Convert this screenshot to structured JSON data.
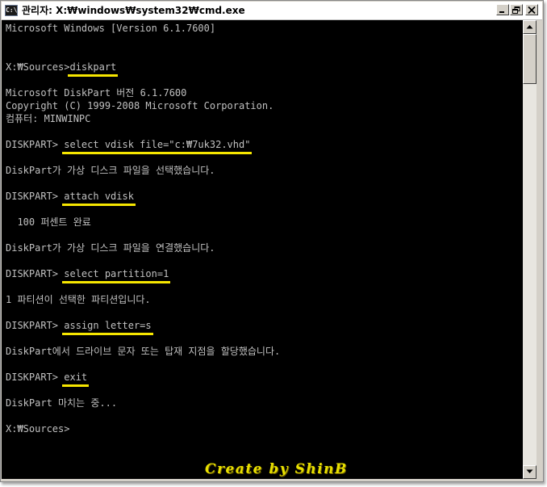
{
  "window": {
    "title": "관리자: X:₩windows₩system32₩cmd.exe",
    "icon_text": "C:\\"
  },
  "console": {
    "lines": [
      {
        "text": "Microsoft Windows [Version 6.1.7600]"
      },
      {
        "text": ""
      },
      {
        "text": ""
      },
      {
        "prompt": "X:₩Sources>",
        "command": "diskpart"
      },
      {
        "text": ""
      },
      {
        "text": "Microsoft DiskPart 버전 6.1.7600"
      },
      {
        "text": "Copyright (C) 1999-2008 Microsoft Corporation."
      },
      {
        "text": "컴퓨터: MINWINPC"
      },
      {
        "text": ""
      },
      {
        "prompt": "DISKPART> ",
        "command": "select vdisk file=\"c:₩7uk32.vhd\""
      },
      {
        "text": ""
      },
      {
        "text": "DiskPart가 가상 디스크 파일을 선택했습니다."
      },
      {
        "text": ""
      },
      {
        "prompt": "DISKPART> ",
        "command": "attach vdisk"
      },
      {
        "text": ""
      },
      {
        "text": "  100 퍼센트 완료"
      },
      {
        "text": ""
      },
      {
        "text": "DiskPart가 가상 디스크 파일을 연결했습니다."
      },
      {
        "text": ""
      },
      {
        "prompt": "DISKPART> ",
        "command": "select partition=1"
      },
      {
        "text": ""
      },
      {
        "text": "1 파티션이 선택한 파티션입니다."
      },
      {
        "text": ""
      },
      {
        "prompt": "DISKPART> ",
        "command": "assign letter=s"
      },
      {
        "text": ""
      },
      {
        "text": "DiskPart에서 드라이브 문자 또는 탑재 지점을 할당했습니다."
      },
      {
        "text": ""
      },
      {
        "prompt": "DISKPART> ",
        "command": "exit"
      },
      {
        "text": ""
      },
      {
        "text": "DiskPart 마치는 중..."
      },
      {
        "text": ""
      },
      {
        "text": "X:₩Sources>"
      }
    ]
  },
  "watermark": {
    "text": "Create by ShinB"
  },
  "colors": {
    "console_bg": "#000000",
    "console_text": "#c0c0c0",
    "highlight_underline": "#f6e600",
    "watermark": "#e8e000"
  },
  "icons": {
    "app": "cmd-icon",
    "minimize": "minimize-icon",
    "maximize": "restore-icon",
    "close": "close-icon",
    "scroll_up": "arrow-up-icon",
    "scroll_down": "arrow-down-icon"
  }
}
